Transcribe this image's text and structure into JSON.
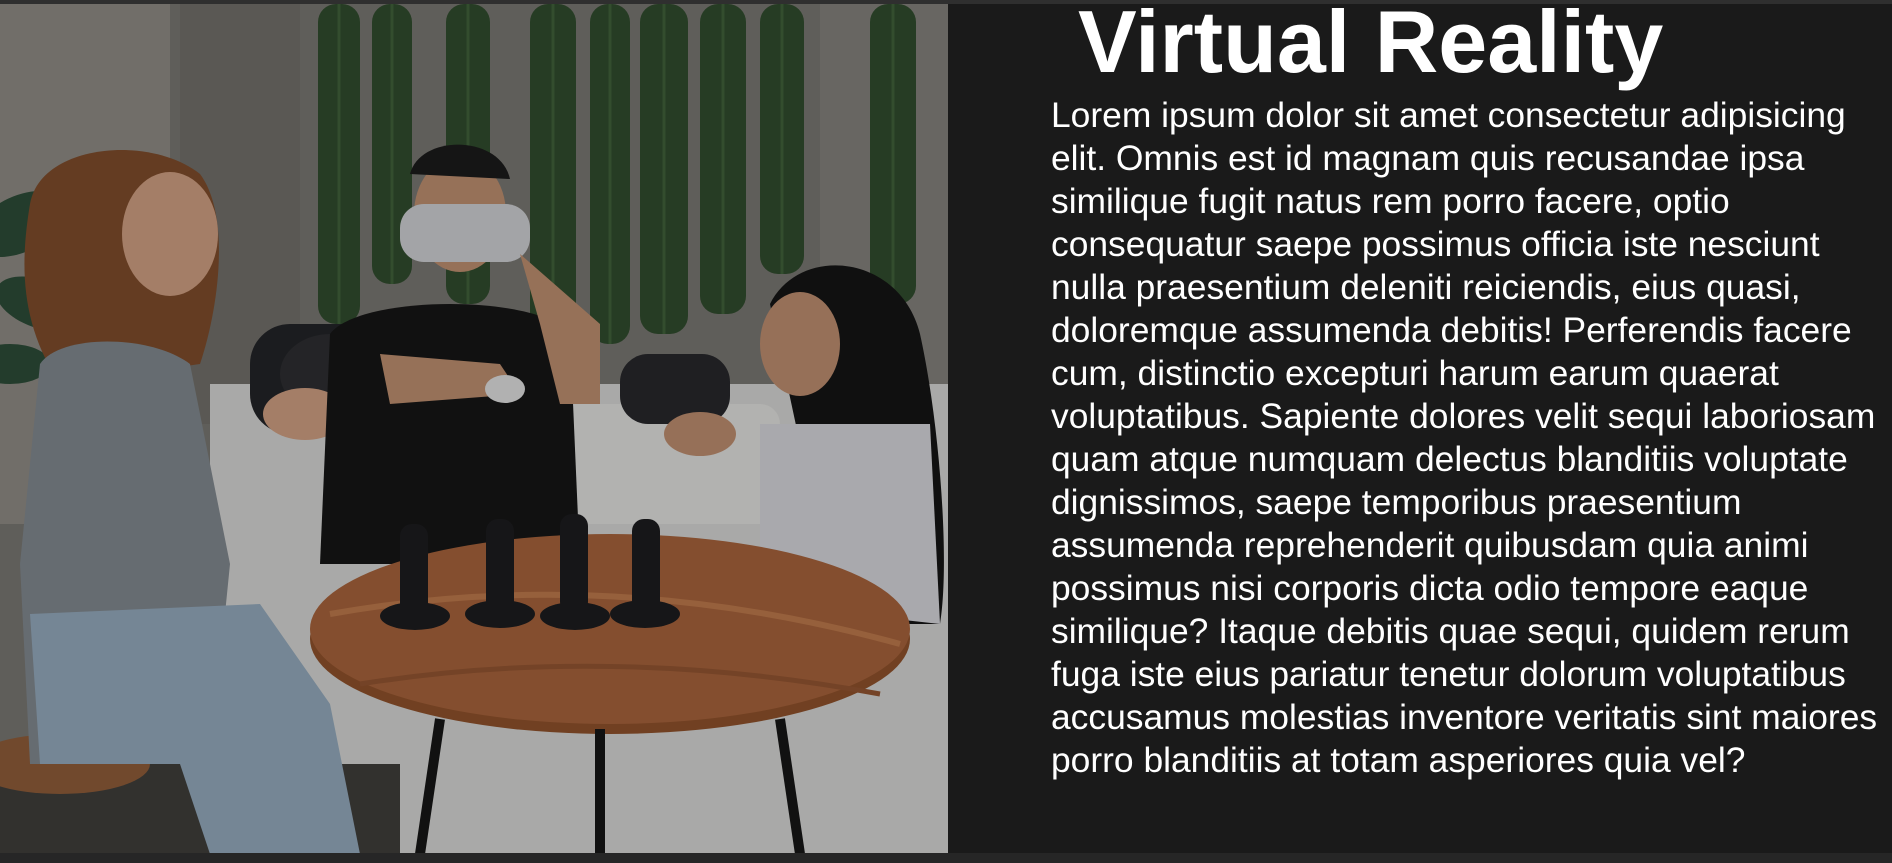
{
  "hero_image": {
    "icon": "vr-group-photo"
  },
  "article": {
    "title": "Virtual Reality",
    "body": "Lorem ipsum dolor sit amet consectetur adipisicing elit. Omnis est id magnam quis recusandae ipsa similique fugit natus rem porro facere, optio consequatur saepe possimus officia iste nesciunt nulla praesentium deleniti reiciendis, eius quasi, doloremque assumenda debitis! Perferendis facere cum, distinctio excepturi harum earum quaerat voluptatibus. Sapiente dolores velit sequi laboriosam quam atque numquam delectus blanditiis voluptate dignissimos, saepe temporibus praesentium assumenda reprehenderit quibusdam quia animi possimus nisi corporis dicta odio tempore eaque similique? Itaque debitis quae sequi, quidem rerum fuga iste eius pariatur tenetur dolorum voluptatibus accusamus molestias inventore veritatis sint maiores porro blanditiis at totam asperiores quia vel?"
  },
  "colors": {
    "page_background": "#1a1a1a",
    "text": "#ffffff"
  }
}
